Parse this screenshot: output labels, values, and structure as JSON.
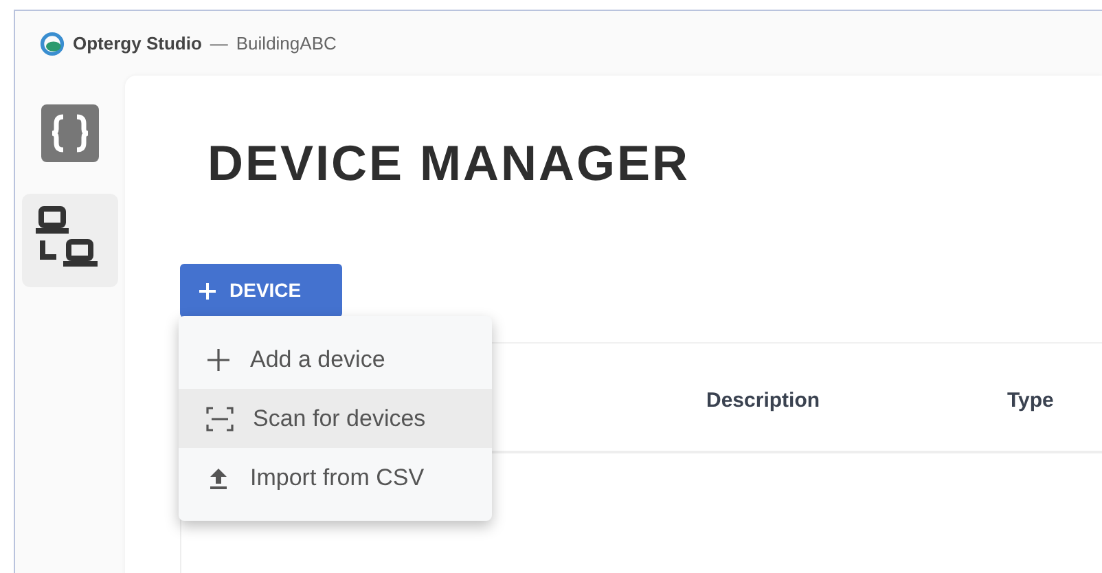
{
  "window": {
    "app": "Optergy Studio",
    "separator": "—",
    "project": "BuildingABC"
  },
  "sidebar": {
    "items": [
      {
        "kind": "code",
        "selected": false
      },
      {
        "kind": "network",
        "selected": true
      }
    ]
  },
  "page": {
    "title": "DEVICE MANAGER"
  },
  "device_button": {
    "label": "DEVICE"
  },
  "menu": {
    "items": [
      {
        "kind": "add",
        "label": "Add a device",
        "selected": false
      },
      {
        "kind": "scan",
        "label": "Scan for devices",
        "selected": true
      },
      {
        "kind": "import",
        "label": "Import from CSV",
        "selected": false
      }
    ]
  },
  "table": {
    "columns": [
      "Description",
      "Type"
    ]
  }
}
